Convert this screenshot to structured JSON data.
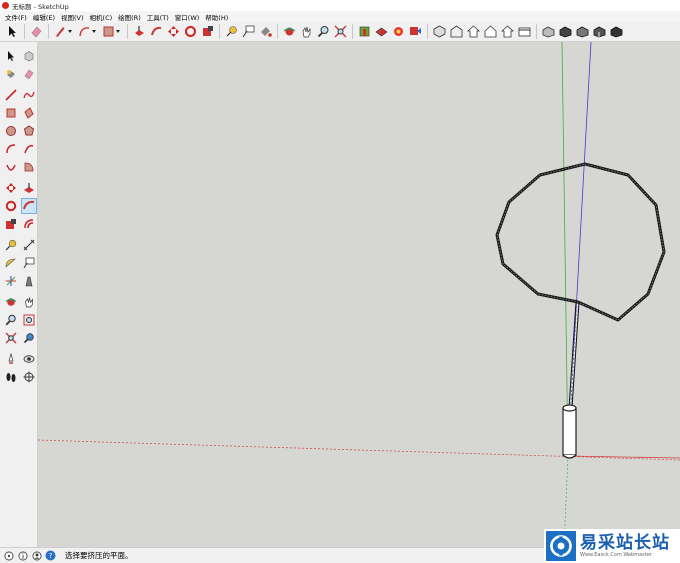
{
  "window": {
    "title": "无标题 - SketchUp"
  },
  "menu": [
    "文件(F)",
    "编辑(E)",
    "视图(V)",
    "相机(C)",
    "绘图(R)",
    "工具(T)",
    "窗口(W)",
    "帮助(H)"
  ],
  "top_toolbar": [
    "select-icon",
    "eraser-icon",
    "pencil-icon",
    "arc-icon",
    "rectangle-icon",
    "push-pull-icon",
    "follow-me-icon",
    "move-icon",
    "rotate-icon",
    "scale-icon",
    "tape-measure-icon",
    "text-label-icon",
    "paint-bucket-icon",
    "orbit-icon",
    "pan-icon",
    "zoom-icon",
    "zoom-extents-icon",
    "warehouse-icon",
    "extension-icon",
    "components-icon",
    "share-icon",
    "iso-view-icon",
    "top-view-icon",
    "front-view-icon",
    "right-view-icon",
    "back-view-icon",
    "left-view-icon",
    "xray-icon",
    "wireframe-icon",
    "hidden-line-icon",
    "shaded-icon",
    "textured-icon"
  ],
  "left_toolbar": [
    [
      "select-icon",
      "component-icon"
    ],
    [
      "paint-bucket-icon",
      "eraser-icon"
    ],
    [
      "line-icon",
      "freehand-icon"
    ],
    [
      "rectangle-icon",
      "rotated-rectangle-icon"
    ],
    [
      "circle-icon",
      "polygon-icon"
    ],
    [
      "arc-icon",
      "two-point-arc-icon"
    ],
    [
      "three-point-arc-icon",
      "pie-icon"
    ],
    [
      "move-icon",
      "push-pull-icon"
    ],
    [
      "rotate-icon",
      "follow-me-icon"
    ],
    [
      "scale-icon",
      "offset-icon"
    ],
    [
      "tape-measure-icon",
      "dimension-icon"
    ],
    [
      "protractor-icon",
      "text-icon"
    ],
    [
      "axes-icon",
      "3d-text-icon"
    ],
    [
      "orbit-icon",
      "pan-icon"
    ],
    [
      "zoom-icon",
      "zoom-window-icon"
    ],
    [
      "zoom-extents-icon",
      "previous-view-icon"
    ],
    [
      "position-camera-icon",
      "look-around-icon"
    ],
    [
      "walk-icon",
      "section-plane-icon"
    ]
  ],
  "status": {
    "text": "选择要挤压的平面。"
  },
  "watermark": {
    "cn": "易采站长站",
    "en": "Www.Easck.Com Webmaster"
  },
  "colors": {
    "viewport_bg": "#d6d6d2",
    "axis_red": "#d04040",
    "axis_green": "#40b040",
    "axis_blue": "#4040d0"
  }
}
